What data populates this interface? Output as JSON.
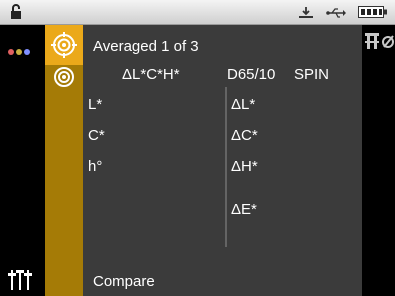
{
  "status": {
    "icons": [
      "lock-open-icon",
      "measurement-head-icon",
      "usb-icon",
      "battery-icon"
    ]
  },
  "mode": {
    "icons": [
      "target-crosshair-icon",
      "target-rings-icon"
    ]
  },
  "header": {
    "title": "Averaged 1 of 3",
    "colorspace": "ΔL*C*H*",
    "illuminant": "D65/10",
    "mode": "SPIN"
  },
  "left_column": {
    "labels": [
      "L*",
      "C*",
      "h°"
    ]
  },
  "right_column": {
    "labels": [
      "ΔL*",
      "ΔC*",
      "ΔH*",
      "ΔE*"
    ]
  },
  "footer": {
    "action_label": "Compare"
  },
  "left_rail": {
    "dot_colors": [
      "#e06060",
      "#c8b040",
      "#8090ff"
    ],
    "icons": [
      "dots-menu-icon",
      "settings-sliders-icon"
    ]
  },
  "right_rail": {
    "icons": [
      "tolerance-icon"
    ]
  },
  "colors": {
    "status_bar": "#dcdcdc",
    "mode_column": "#a57b06",
    "mode_active": "#eba91a",
    "panel": "#3b3b3b",
    "text": "#ffffff"
  }
}
